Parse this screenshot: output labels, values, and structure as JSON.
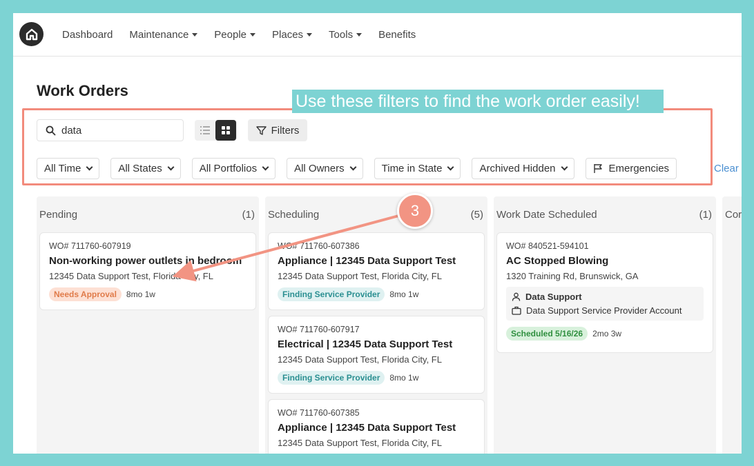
{
  "nav": {
    "items": [
      {
        "label": "Dashboard",
        "caret": false
      },
      {
        "label": "Maintenance",
        "caret": true
      },
      {
        "label": "People",
        "caret": true
      },
      {
        "label": "Places",
        "caret": true
      },
      {
        "label": "Tools",
        "caret": true
      },
      {
        "label": "Benefits",
        "caret": false
      }
    ]
  },
  "page": {
    "title": "Work Orders"
  },
  "callout": {
    "text": "Use these filters to find the work order easily!",
    "step_number": "3"
  },
  "search": {
    "value": "data"
  },
  "toolbar": {
    "filters_label": "Filters"
  },
  "dropdowns": [
    "All Time",
    "All States",
    "All Portfolios",
    "All Owners",
    "Time in State",
    "Archived Hidden"
  ],
  "emergencies_label": "Emergencies",
  "clear_label": "Clear",
  "columns": [
    {
      "name": "Pending",
      "count": "(1)",
      "cards": [
        {
          "wo": "WO# 711760-607919",
          "title": "Non-working power outlets in bedroom",
          "address": "12345 Data Support Test, Florida City, FL",
          "badge": "Needs Approval",
          "badge_type": "approval",
          "age": "8mo 1w"
        }
      ]
    },
    {
      "name": "Scheduling",
      "count": "(5)",
      "cards": [
        {
          "wo": "WO# 711760-607386",
          "title": "Appliance | 12345 Data Support Test",
          "address": "12345 Data Support Test, Florida City, FL",
          "badge": "Finding Service Provider",
          "badge_type": "finding",
          "age": "8mo 1w"
        },
        {
          "wo": "WO# 711760-607917",
          "title": "Electrical | 12345 Data Support Test",
          "address": "12345 Data Support Test, Florida City, FL",
          "badge": "Finding Service Provider",
          "badge_type": "finding",
          "age": "8mo 1w"
        },
        {
          "wo": "WO# 711760-607385",
          "title": "Appliance | 12345 Data Support Test",
          "address": "12345 Data Support Test, Florida City, FL"
        }
      ]
    },
    {
      "name": "Work Date Scheduled",
      "count": "(1)",
      "cards": [
        {
          "wo": "WO# 840521-594101",
          "title": "AC Stopped Blowing",
          "address": "1320 Training Rd, Brunswick, GA",
          "assignee_person": "Data Support",
          "assignee_account": "Data Support Service Provider Account",
          "badge": "Scheduled 5/16/26",
          "badge_type": "scheduled",
          "age": "2mo 3w"
        }
      ]
    },
    {
      "name": "Cor",
      "count": ""
    }
  ],
  "colors": {
    "accent_teal": "#7dd3d3",
    "highlight_coral": "#f28b7c",
    "link_blue": "#4a8fd1"
  }
}
